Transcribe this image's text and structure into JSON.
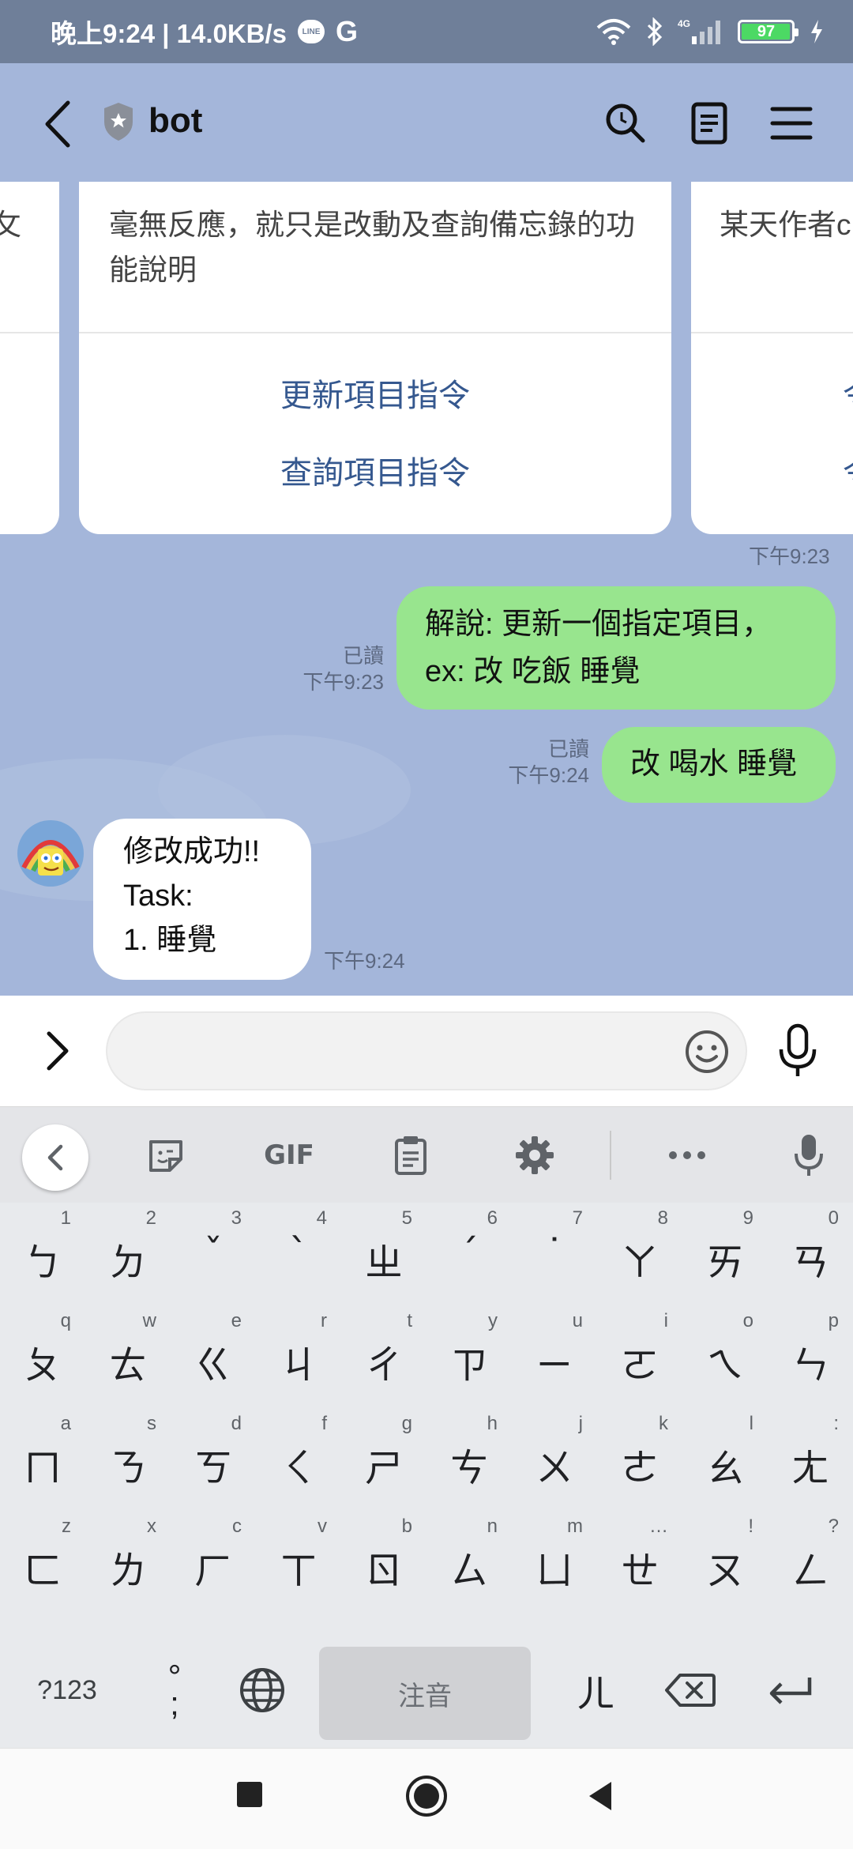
{
  "status_bar": {
    "time_speed": "晚上9:24 | 14.0KB/s",
    "line_badge": "LINE",
    "g": "G",
    "battery": "97",
    "network": "4G"
  },
  "header": {
    "title": "bot"
  },
  "chat": {
    "cards": {
      "left_partial": "攵",
      "main_description": "毫無反應，就只是改動及查詢備忘錄的功能說明",
      "main_actions": [
        "更新項目指令",
        "查詢項目指令"
      ],
      "right_partial": "某天作者c",
      "right_actions": [
        "令",
        "令"
      ],
      "time": "下午9:23"
    },
    "messages": [
      {
        "side": "right",
        "lines": [
          "解說: 更新一個指定項目，",
          "ex: 改 吃飯 睡覺"
        ],
        "read": "已讀",
        "time": "下午9:23"
      },
      {
        "side": "right",
        "lines": [
          "改 喝水 睡覺"
        ],
        "read": "已讀",
        "time": "下午9:24"
      },
      {
        "side": "left",
        "lines": [
          "修改成功!!",
          "Task:",
          "1. 睡覺"
        ],
        "time": "下午9:24"
      }
    ]
  },
  "input": {
    "placeholder": ""
  },
  "keyboard": {
    "toolbar": {
      "gif": "GIF"
    },
    "rows": [
      [
        [
          "1",
          "ㄅ"
        ],
        [
          "2",
          "ㄉ"
        ],
        [
          "3",
          "ˇ"
        ],
        [
          "4",
          "ˋ"
        ],
        [
          "5",
          "ㄓ"
        ],
        [
          "6",
          "ˊ"
        ],
        [
          "7",
          "˙"
        ],
        [
          "8",
          "ㄚ"
        ],
        [
          "9",
          "ㄞ"
        ],
        [
          "0",
          "ㄢ"
        ]
      ],
      [
        [
          "q",
          "ㄆ"
        ],
        [
          "w",
          "ㄊ"
        ],
        [
          "e",
          "ㄍ"
        ],
        [
          "r",
          "ㄐ"
        ],
        [
          "t",
          "ㄔ"
        ],
        [
          "y",
          "ㄗ"
        ],
        [
          "u",
          "ㄧ"
        ],
        [
          "i",
          "ㄛ"
        ],
        [
          "o",
          "ㄟ"
        ],
        [
          "p",
          "ㄣ"
        ]
      ],
      [
        [
          "a",
          "ㄇ"
        ],
        [
          "s",
          "ㄋ"
        ],
        [
          "d",
          "ㄎ"
        ],
        [
          "f",
          "ㄑ"
        ],
        [
          "g",
          "ㄕ"
        ],
        [
          "h",
          "ㄘ"
        ],
        [
          "j",
          "ㄨ"
        ],
        [
          "k",
          "ㄜ"
        ],
        [
          "l",
          "ㄠ"
        ],
        [
          ":",
          "ㄤ"
        ]
      ],
      [
        [
          "z",
          "ㄈ"
        ],
        [
          "x",
          "ㄌ"
        ],
        [
          "c",
          "ㄏ"
        ],
        [
          "v",
          "ㄒ"
        ],
        [
          "b",
          "ㄖ"
        ],
        [
          "n",
          "ㄙ"
        ],
        [
          "m",
          "ㄩ"
        ],
        [
          "…",
          "ㄝ"
        ],
        [
          "!",
          "ㄡ"
        ],
        [
          "?",
          "ㄥ"
        ]
      ]
    ],
    "bottom": {
      "symbols": "?123",
      "punct_top": "°",
      "punct_bottom": ";",
      "space": "注音",
      "er": "ㄦ"
    }
  },
  "colors": {
    "header_bg": "#a4b6da",
    "status_bg": "#6f7f99",
    "bubble_green": "#98e58e",
    "link_blue": "#35588f"
  }
}
